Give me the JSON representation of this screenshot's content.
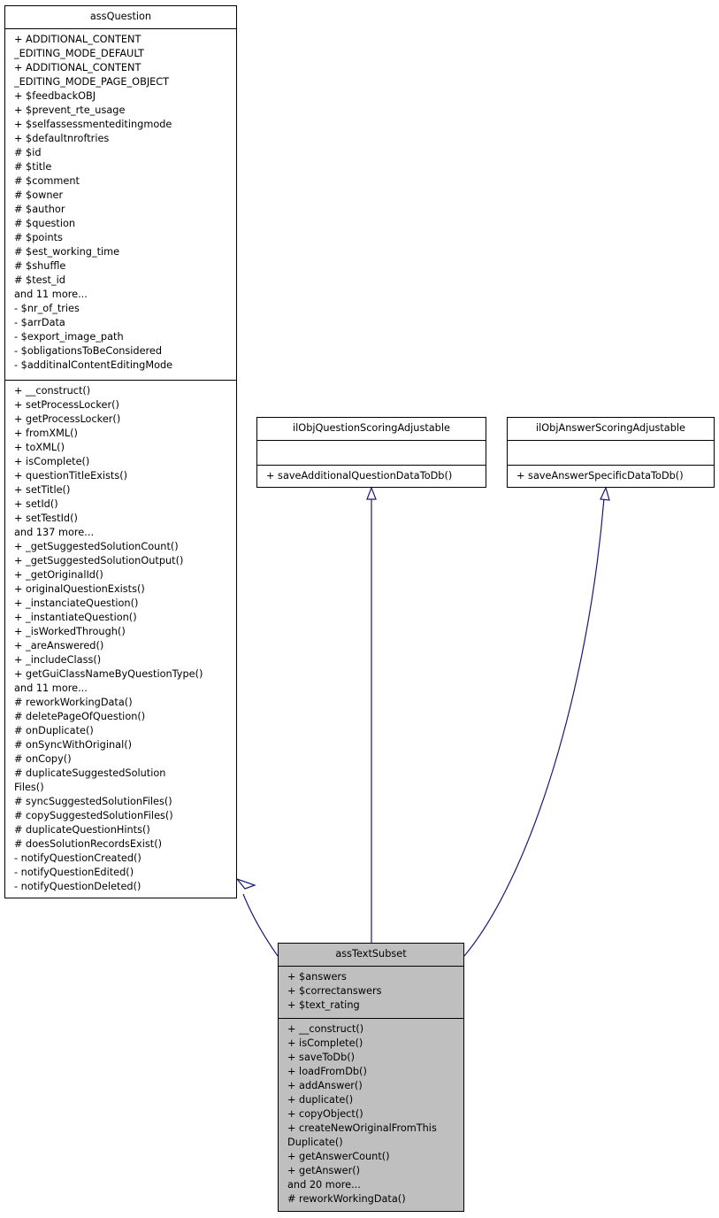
{
  "diagram": {
    "type": "UML class inheritance diagram",
    "edge_color": "#191970",
    "highlight_fill": "#bfbfbf",
    "classes": {
      "assQuestion": {
        "name": "assQuestion",
        "attributes": [
          "+ ADDITIONAL_CONTENT",
          "_EDITING_MODE_DEFAULT",
          "+ ADDITIONAL_CONTENT",
          "_EDITING_MODE_PAGE_OBJECT",
          "+ $feedbackOBJ",
          "+ $prevent_rte_usage",
          "+ $selfassessmenteditingmode",
          "+ $defaultnroftries",
          "# $id",
          "# $title",
          "# $comment",
          "# $owner",
          "# $author",
          "# $question",
          "# $points",
          "# $est_working_time",
          "# $shuffle",
          "# $test_id",
          "and 11 more...",
          "- $nr_of_tries",
          "- $arrData",
          "- $export_image_path",
          "- $obligationsToBeConsidered",
          "- $additinalContentEditingMode"
        ],
        "methods": [
          "+ __construct()",
          "+ setProcessLocker()",
          "+ getProcessLocker()",
          "+ fromXML()",
          "+ toXML()",
          "+ isComplete()",
          "+ questionTitleExists()",
          "+ setTitle()",
          "+ setId()",
          "+ setTestId()",
          "and 137 more...",
          "+ _getSuggestedSolutionCount()",
          "+ _getSuggestedSolutionOutput()",
          "+ _getOriginalId()",
          "+ originalQuestionExists()",
          "+ _instanciateQuestion()",
          "+ _instantiateQuestion()",
          "+ _isWorkedThrough()",
          "+ _areAnswered()",
          "+ _includeClass()",
          "+ getGuiClassNameByQuestionType()",
          "and 11 more...",
          "# reworkWorkingData()",
          "# deletePageOfQuestion()",
          "# onDuplicate()",
          "# onSyncWithOriginal()",
          "# onCopy()",
          "# duplicateSuggestedSolution",
          "Files()",
          "# syncSuggestedSolutionFiles()",
          "# copySuggestedSolutionFiles()",
          "# duplicateQuestionHints()",
          "# doesSolutionRecordsExist()",
          "- notifyQuestionCreated()",
          "- notifyQuestionEdited()",
          "- notifyQuestionDeleted()"
        ]
      },
      "ilObjQuestionScoringAdjustable": {
        "name": "ilObjQuestionScoringAdjustable",
        "attributes": [],
        "methods": [
          "+ saveAdditionalQuestionDataToDb()"
        ]
      },
      "ilObjAnswerScoringAdjustable": {
        "name": "ilObjAnswerScoringAdjustable",
        "attributes": [],
        "methods": [
          "+ saveAnswerSpecificDataToDb()"
        ]
      },
      "assTextSubset": {
        "name": "assTextSubset",
        "attributes": [
          "+ $answers",
          "+ $correctanswers",
          "+ $text_rating"
        ],
        "methods": [
          "+ __construct()",
          "+ isComplete()",
          "+ saveToDb()",
          "+ loadFromDb()",
          "+ addAnswer()",
          "+ duplicate()",
          "+ copyObject()",
          "+ createNewOriginalFromThis",
          "Duplicate()",
          "+ getAnswerCount()",
          "+ getAnswer()",
          "and 20 more...",
          "# reworkWorkingData()"
        ]
      }
    },
    "edges": [
      {
        "from": "assTextSubset",
        "to": "assQuestion",
        "kind": "inheritance"
      },
      {
        "from": "assTextSubset",
        "to": "ilObjQuestionScoringAdjustable",
        "kind": "inheritance"
      },
      {
        "from": "assTextSubset",
        "to": "ilObjAnswerScoringAdjustable",
        "kind": "inheritance"
      }
    ]
  }
}
